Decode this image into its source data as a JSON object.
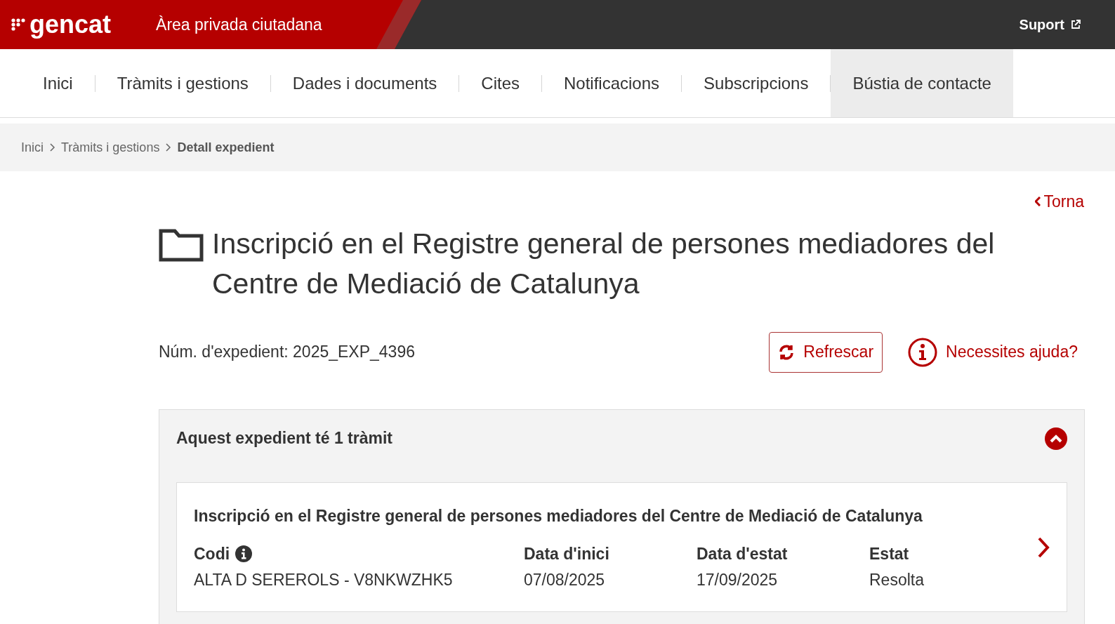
{
  "header": {
    "logo": "gencat",
    "title": "Àrea privada ciutadana",
    "support_link": "Suport"
  },
  "nav": [
    {
      "label": "Inici",
      "selected": false
    },
    {
      "label": "Tràmits i gestions",
      "selected": false
    },
    {
      "label": "Dades i documents",
      "selected": false
    },
    {
      "label": "Cites",
      "selected": false
    },
    {
      "label": "Notificacions",
      "selected": false
    },
    {
      "label": "Subscripcions",
      "selected": false
    },
    {
      "label": "Bústia de contacte",
      "selected": true
    }
  ],
  "breadcrumb": [
    {
      "label": "Inici",
      "current": false
    },
    {
      "label": "Tràmits i gestions",
      "current": false
    },
    {
      "label": "Detall expedient",
      "current": true
    }
  ],
  "back_link": "Torna",
  "page_title": "Inscripció en el Registre general de persones mediadores del Centre de Mediació de Catalunya",
  "file_number": "Núm. d'expedient: 2025_EXP_4396",
  "refresh_button": "Refrescar",
  "help_link": "Necessites ajuda?",
  "accordion": {
    "title": "Aquest expedient té 1 tràmit",
    "expanded": true,
    "procedures": [
      {
        "title": "Inscripció en el Registre general de persones mediadores del Centre de Mediació de Catalunya",
        "fields": [
          {
            "label": "Codi",
            "value": "ALTA D SEREROLS - V8NKWZHK5",
            "info": true
          },
          {
            "label": "Data d'inici",
            "value": "07/08/2025",
            "info": false
          },
          {
            "label": "Data d'estat",
            "value": "17/09/2025",
            "info": false
          },
          {
            "label": "Estat",
            "value": "Resolta",
            "info": false
          }
        ]
      }
    ]
  }
}
